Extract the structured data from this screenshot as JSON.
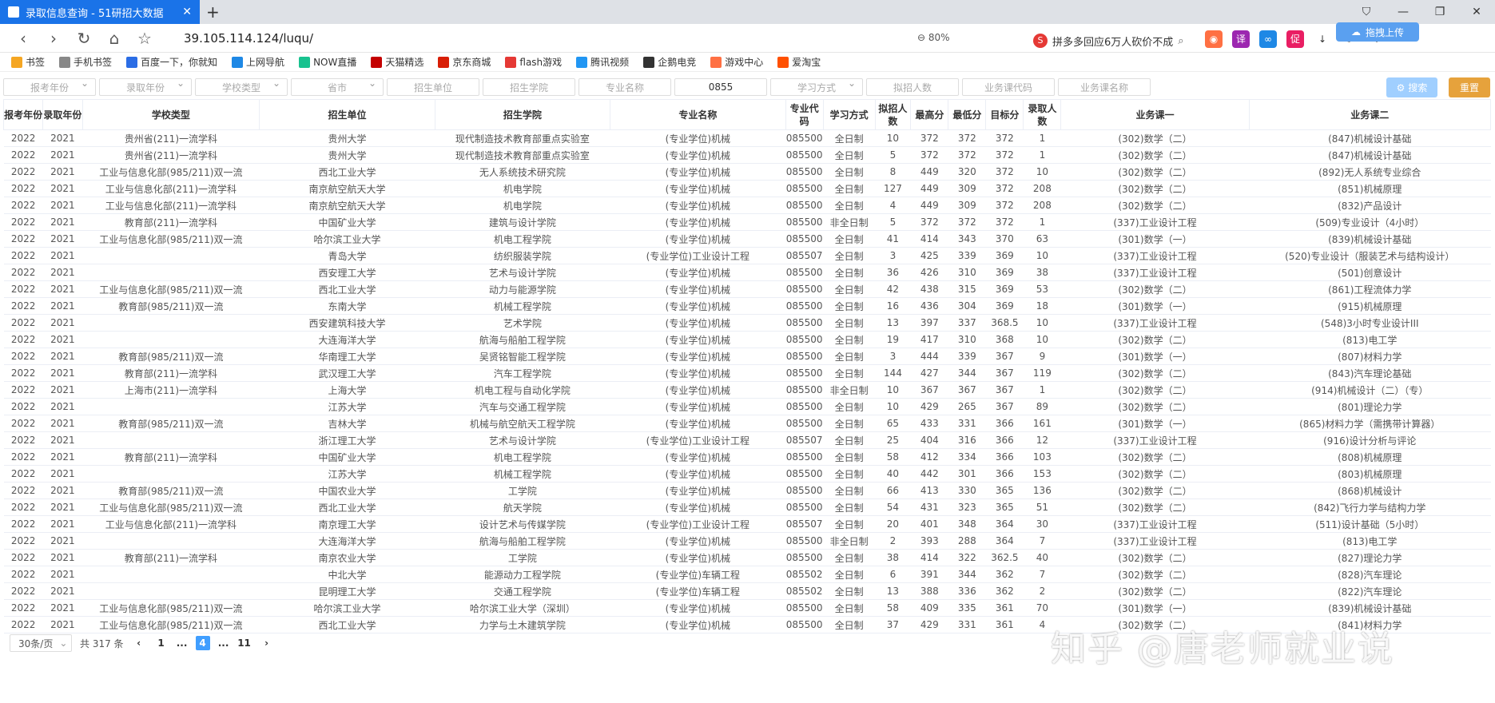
{
  "browser": {
    "tab_title": "录取信息查询 - 51研招大数据",
    "url": "39.105.114.124/luqu/",
    "zoom": "80%",
    "search_text": "拼多多回应6万人砍价不成",
    "upload_label": "拖拽上传"
  },
  "bookmarks": [
    {
      "label": "书签",
      "icon": "star-icon",
      "color": "#f5a623"
    },
    {
      "label": "手机书签",
      "icon": "phone-icon",
      "color": "#888888"
    },
    {
      "label": "百度一下，你就知",
      "icon": "baidu-icon",
      "color": "#2b6de5"
    },
    {
      "label": "上网导航",
      "icon": "ie-icon",
      "color": "#1e88e5"
    },
    {
      "label": "NOW直播",
      "icon": "now-icon",
      "color": "#18c28f"
    },
    {
      "label": "天猫精选",
      "icon": "tmall-icon",
      "color": "#c40000"
    },
    {
      "label": "京东商城",
      "icon": "jd-icon",
      "color": "#d81e06"
    },
    {
      "label": "flash游戏",
      "icon": "flash-icon",
      "color": "#e53935"
    },
    {
      "label": "腾讯视频",
      "icon": "video-icon",
      "color": "#2196f3"
    },
    {
      "label": "企鹅电竞",
      "icon": "penguin-icon",
      "color": "#333333"
    },
    {
      "label": "游戏中心",
      "icon": "gamepad-icon",
      "color": "#ff7043"
    },
    {
      "label": "爱淘宝",
      "icon": "taobao-icon",
      "color": "#ff5000"
    }
  ],
  "filters": [
    {
      "placeholder": "报考年份",
      "select": true,
      "width": 116
    },
    {
      "placeholder": "录取年份",
      "select": true,
      "width": 116
    },
    {
      "placeholder": "学校类型",
      "select": true,
      "width": 116
    },
    {
      "placeholder": "省市",
      "select": true,
      "width": 116
    },
    {
      "placeholder": "招生单位",
      "select": false,
      "width": 116
    },
    {
      "placeholder": "招生学院",
      "select": false,
      "width": 116
    },
    {
      "placeholder": "专业名称",
      "select": false,
      "width": 116
    },
    {
      "placeholder": "0855",
      "select": false,
      "width": 116,
      "filled": true
    },
    {
      "placeholder": "学习方式",
      "select": true,
      "width": 116
    },
    {
      "placeholder": "拟招人数",
      "select": false,
      "width": 116
    },
    {
      "placeholder": "业务课代码",
      "select": false,
      "width": 116
    },
    {
      "placeholder": "业务课名称",
      "select": false,
      "width": 116
    }
  ],
  "buttons": {
    "search": "搜索",
    "reset": "重置"
  },
  "columns": [
    "报考年份",
    "录取年份",
    "学校类型",
    "招生单位",
    "招生学院",
    "专业名称",
    "专业代码",
    "学习方式",
    "拟招人数",
    "最高分",
    "最低分",
    "目标分",
    "录取人数",
    "业务课一",
    "业务课二"
  ],
  "rows": [
    [
      "2022",
      "2021",
      "贵州省(211)一流学科",
      "贵州大学",
      "现代制造技术教育部重点实验室",
      "(专业学位)机械",
      "085500",
      "全日制",
      "10",
      "372",
      "372",
      "372",
      "1",
      "(302)数学（二）",
      "(847)机械设计基础"
    ],
    [
      "2022",
      "2021",
      "贵州省(211)一流学科",
      "贵州大学",
      "现代制造技术教育部重点实验室",
      "(专业学位)机械",
      "085500",
      "全日制",
      "5",
      "372",
      "372",
      "372",
      "1",
      "(302)数学（二）",
      "(847)机械设计基础"
    ],
    [
      "2022",
      "2021",
      "工业与信息化部(985/211)双一流",
      "西北工业大学",
      "无人系统技术研究院",
      "(专业学位)机械",
      "085500",
      "全日制",
      "8",
      "449",
      "320",
      "372",
      "10",
      "(302)数学（二）",
      "(892)无人系统专业综合"
    ],
    [
      "2022",
      "2021",
      "工业与信息化部(211)一流学科",
      "南京航空航天大学",
      "机电学院",
      "(专业学位)机械",
      "085500",
      "全日制",
      "127",
      "449",
      "309",
      "372",
      "208",
      "(302)数学（二）",
      "(851)机械原理"
    ],
    [
      "2022",
      "2021",
      "工业与信息化部(211)一流学科",
      "南京航空航天大学",
      "机电学院",
      "(专业学位)机械",
      "085500",
      "全日制",
      "4",
      "449",
      "309",
      "372",
      "208",
      "(302)数学（二）",
      "(832)产品设计"
    ],
    [
      "2022",
      "2021",
      "教育部(211)一流学科",
      "中国矿业大学",
      "建筑与设计学院",
      "(专业学位)机械",
      "085500",
      "非全日制",
      "5",
      "372",
      "372",
      "372",
      "1",
      "(337)工业设计工程",
      "(509)专业设计（4小时）"
    ],
    [
      "2022",
      "2021",
      "工业与信息化部(985/211)双一流",
      "哈尔滨工业大学",
      "机电工程学院",
      "(专业学位)机械",
      "085500",
      "全日制",
      "41",
      "414",
      "343",
      "370",
      "63",
      "(301)数学（一）",
      "(839)机械设计基础"
    ],
    [
      "2022",
      "2021",
      "",
      "青岛大学",
      "纺织服装学院",
      "(专业学位)工业设计工程",
      "085507",
      "全日制",
      "3",
      "425",
      "339",
      "369",
      "10",
      "(337)工业设计工程",
      "(520)专业设计（服装艺术与结构设计）"
    ],
    [
      "2022",
      "2021",
      "",
      "西安理工大学",
      "艺术与设计学院",
      "(专业学位)机械",
      "085500",
      "全日制",
      "36",
      "426",
      "310",
      "369",
      "38",
      "(337)工业设计工程",
      "(501)创意设计"
    ],
    [
      "2022",
      "2021",
      "工业与信息化部(985/211)双一流",
      "西北工业大学",
      "动力与能源学院",
      "(专业学位)机械",
      "085500",
      "全日制",
      "42",
      "438",
      "315",
      "369",
      "53",
      "(302)数学（二）",
      "(861)工程流体力学"
    ],
    [
      "2022",
      "2021",
      "教育部(985/211)双一流",
      "东南大学",
      "机械工程学院",
      "(专业学位)机械",
      "085500",
      "全日制",
      "16",
      "436",
      "304",
      "369",
      "18",
      "(301)数学（一）",
      "(915)机械原理"
    ],
    [
      "2022",
      "2021",
      "",
      "西安建筑科技大学",
      "艺术学院",
      "(专业学位)机械",
      "085500",
      "全日制",
      "13",
      "397",
      "337",
      "368.5",
      "10",
      "(337)工业设计工程",
      "(548)3小时专业设计III"
    ],
    [
      "2022",
      "2021",
      "",
      "大连海洋大学",
      "航海与船舶工程学院",
      "(专业学位)机械",
      "085500",
      "全日制",
      "19",
      "417",
      "310",
      "368",
      "10",
      "(302)数学（二）",
      "(813)电工学"
    ],
    [
      "2022",
      "2021",
      "教育部(985/211)双一流",
      "华南理工大学",
      "吴贤铭智能工程学院",
      "(专业学位)机械",
      "085500",
      "全日制",
      "3",
      "444",
      "339",
      "367",
      "9",
      "(301)数学（一）",
      "(807)材料力学"
    ],
    [
      "2022",
      "2021",
      "教育部(211)一流学科",
      "武汉理工大学",
      "汽车工程学院",
      "(专业学位)机械",
      "085500",
      "全日制",
      "144",
      "427",
      "344",
      "367",
      "119",
      "(302)数学（二）",
      "(843)汽车理论基础"
    ],
    [
      "2022",
      "2021",
      "上海市(211)一流学科",
      "上海大学",
      "机电工程与自动化学院",
      "(专业学位)机械",
      "085500",
      "非全日制",
      "10",
      "367",
      "367",
      "367",
      "1",
      "(302)数学（二）",
      "(914)机械设计（二）（专）"
    ],
    [
      "2022",
      "2021",
      "",
      "江苏大学",
      "汽车与交通工程学院",
      "(专业学位)机械",
      "085500",
      "全日制",
      "10",
      "429",
      "265",
      "367",
      "89",
      "(302)数学（二）",
      "(801)理论力学"
    ],
    [
      "2022",
      "2021",
      "教育部(985/211)双一流",
      "吉林大学",
      "机械与航空航天工程学院",
      "(专业学位)机械",
      "085500",
      "全日制",
      "65",
      "433",
      "331",
      "366",
      "161",
      "(301)数学（一）",
      "(865)材料力学（需携带计算器）"
    ],
    [
      "2022",
      "2021",
      "",
      "浙江理工大学",
      "艺术与设计学院",
      "(专业学位)工业设计工程",
      "085507",
      "全日制",
      "25",
      "404",
      "316",
      "366",
      "12",
      "(337)工业设计工程",
      "(916)设计分析与评论"
    ],
    [
      "2022",
      "2021",
      "教育部(211)一流学科",
      "中国矿业大学",
      "机电工程学院",
      "(专业学位)机械",
      "085500",
      "全日制",
      "58",
      "412",
      "334",
      "366",
      "103",
      "(302)数学（二）",
      "(808)机械原理"
    ],
    [
      "2022",
      "2021",
      "",
      "江苏大学",
      "机械工程学院",
      "(专业学位)机械",
      "085500",
      "全日制",
      "40",
      "442",
      "301",
      "366",
      "153",
      "(302)数学（二）",
      "(803)机械原理"
    ],
    [
      "2022",
      "2021",
      "教育部(985/211)双一流",
      "中国农业大学",
      "工学院",
      "(专业学位)机械",
      "085500",
      "全日制",
      "66",
      "413",
      "330",
      "365",
      "136",
      "(302)数学（二）",
      "(868)机械设计"
    ],
    [
      "2022",
      "2021",
      "工业与信息化部(985/211)双一流",
      "西北工业大学",
      "航天学院",
      "(专业学位)机械",
      "085500",
      "全日制",
      "54",
      "431",
      "323",
      "365",
      "51",
      "(302)数学（二）",
      "(842)飞行力学与结构力学"
    ],
    [
      "2022",
      "2021",
      "工业与信息化部(211)一流学科",
      "南京理工大学",
      "设计艺术与传媒学院",
      "(专业学位)工业设计工程",
      "085507",
      "全日制",
      "20",
      "401",
      "348",
      "364",
      "30",
      "(337)工业设计工程",
      "(511)设计基础（5小时）"
    ],
    [
      "2022",
      "2021",
      "",
      "大连海洋大学",
      "航海与船舶工程学院",
      "(专业学位)机械",
      "085500",
      "非全日制",
      "2",
      "393",
      "288",
      "364",
      "7",
      "(337)工业设计工程",
      "(813)电工学"
    ],
    [
      "2022",
      "2021",
      "教育部(211)一流学科",
      "南京农业大学",
      "工学院",
      "(专业学位)机械",
      "085500",
      "全日制",
      "38",
      "414",
      "322",
      "362.5",
      "40",
      "(302)数学（二）",
      "(827)理论力学"
    ],
    [
      "2022",
      "2021",
      "",
      "中北大学",
      "能源动力工程学院",
      "(专业学位)车辆工程",
      "085502",
      "全日制",
      "6",
      "391",
      "344",
      "362",
      "7",
      "(302)数学（二）",
      "(828)汽车理论"
    ],
    [
      "2022",
      "2021",
      "",
      "昆明理工大学",
      "交通工程学院",
      "(专业学位)车辆工程",
      "085502",
      "全日制",
      "13",
      "388",
      "336",
      "362",
      "2",
      "(302)数学（二）",
      "(822)汽车理论"
    ],
    [
      "2022",
      "2021",
      "工业与信息化部(985/211)双一流",
      "哈尔滨工业大学",
      "哈尔滨工业大学（深圳）",
      "(专业学位)机械",
      "085500",
      "全日制",
      "58",
      "409",
      "335",
      "361",
      "70",
      "(301)数学（一）",
      "(839)机械设计基础"
    ],
    [
      "2022",
      "2021",
      "工业与信息化部(985/211)双一流",
      "西北工业大学",
      "力学与土木建筑学院",
      "(专业学位)机械",
      "085500",
      "全日制",
      "37",
      "429",
      "331",
      "361",
      "4",
      "(302)数学（二）",
      "(841)材料力学"
    ]
  ],
  "pagination": {
    "page_size": "30条/页",
    "total": "共 317 条",
    "pages": [
      "1",
      "...",
      "4",
      "...",
      "11"
    ],
    "current": "4"
  },
  "watermark": "知乎 @唐老师就业说"
}
